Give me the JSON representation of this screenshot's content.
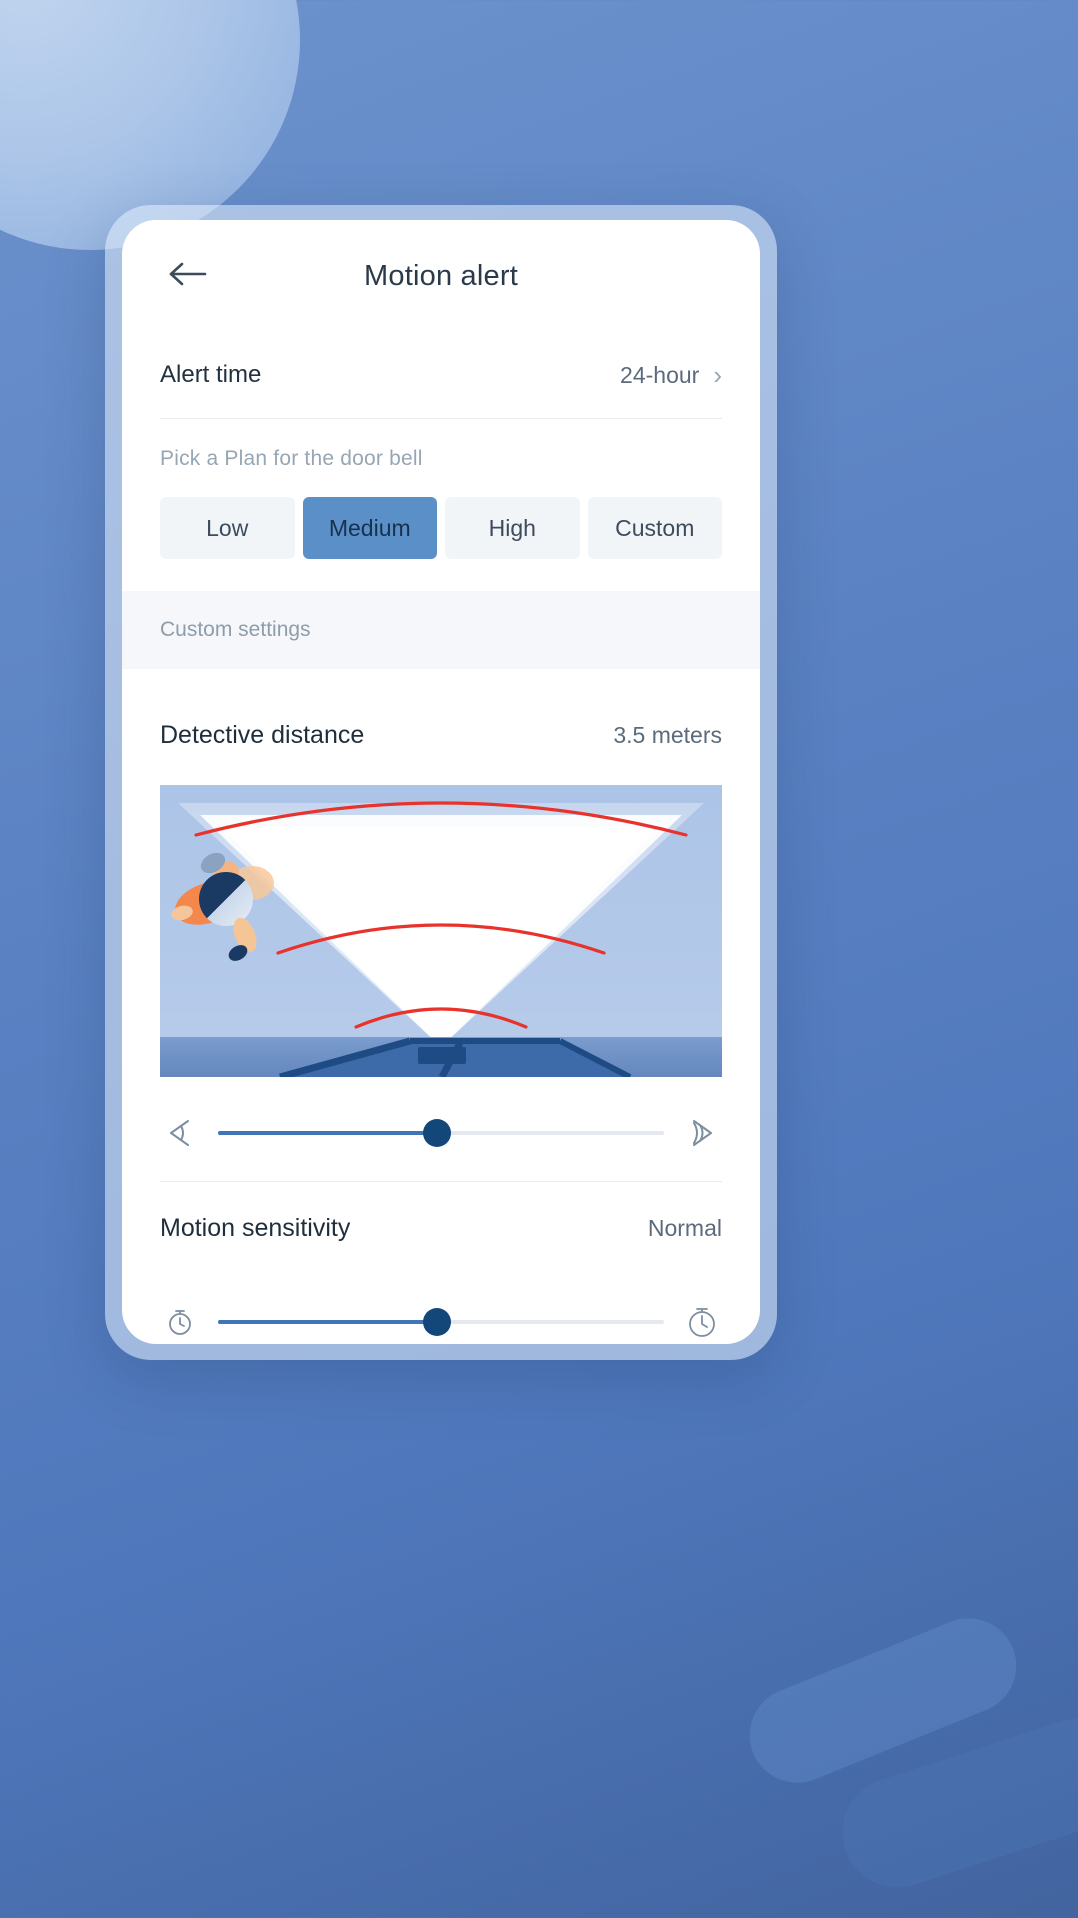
{
  "header": {
    "title": "Motion alert",
    "back_icon": "arrow-left-icon"
  },
  "alert_time": {
    "label": "Alert time",
    "value": "24-hour",
    "chevron": "›"
  },
  "plan": {
    "hint": "Pick a Plan for the door bell",
    "options": [
      {
        "label": "Low",
        "selected": false
      },
      {
        "label": "Medium",
        "selected": true
      },
      {
        "label": "High",
        "selected": false
      },
      {
        "label": "Custom",
        "selected": false
      }
    ],
    "selected": "Medium"
  },
  "custom_settings": {
    "band_label": "Custom settings"
  },
  "detective_distance": {
    "label": "Detective distance",
    "value": "3.5 meters",
    "slider": {
      "percent": 49,
      "left_icon": "narrow-angle-icon",
      "right_icon": "wide-angle-icon"
    }
  },
  "motion_sensitivity": {
    "label": "Motion sensitivity",
    "value": "Normal",
    "slider": {
      "percent": 49,
      "left_icon": "timer-small-icon",
      "right_icon": "timer-large-icon"
    }
  },
  "illustration": {
    "name": "detection-cone-illustration",
    "person": "walking-person",
    "device": "doorbell-device",
    "arc_color": "#e8322c",
    "cone_color": "#ffffff",
    "bg_color": "#b6cbea",
    "floor_color": "#6f93c7"
  },
  "colors": {
    "brand_blue": "#5b8fc7",
    "track_fill": "#3f76b8",
    "thumb": "#134679",
    "page_bg": "#5d84c4"
  }
}
